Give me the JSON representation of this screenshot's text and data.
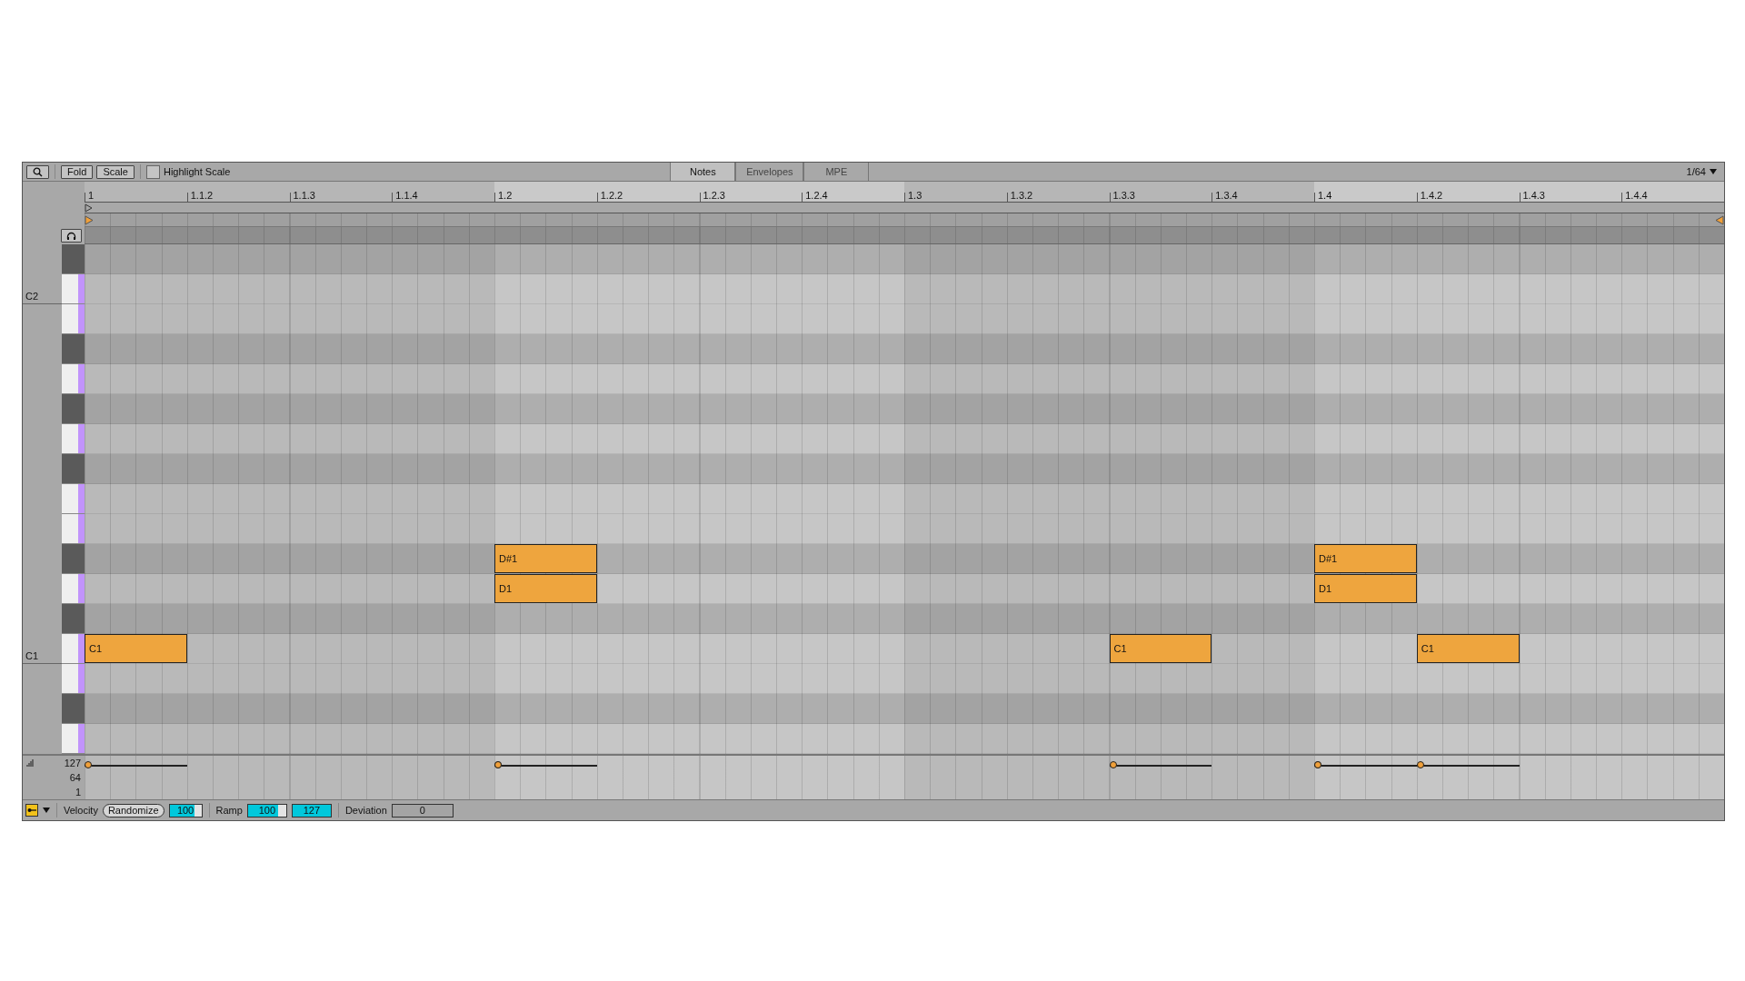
{
  "toolbar": {
    "buttons": [
      "Fold",
      "Scale"
    ],
    "highlight_scale": {
      "label": "Highlight Scale",
      "checked": false
    }
  },
  "tabs": [
    {
      "label": "Notes",
      "selected": true
    },
    {
      "label": "Envelopes",
      "selected": false
    },
    {
      "label": "MPE",
      "selected": false
    }
  ],
  "grid_size": "1/64",
  "ruler": [
    "1",
    "1.1.2",
    "1.1.3",
    "1.1.4",
    "1.2",
    "1.2.2",
    "1.2.3",
    "1.2.4",
    "1.3",
    "1.3.2",
    "1.3.3",
    "1.3.4",
    "1.4",
    "1.4.2",
    "1.4.3",
    "1.4.4"
  ],
  "keys": [
    {
      "kind": "black"
    },
    {
      "kind": "white",
      "label": "C2"
    },
    {
      "kind": "white"
    },
    {
      "kind": "black"
    },
    {
      "kind": "white"
    },
    {
      "kind": "black"
    },
    {
      "kind": "white"
    },
    {
      "kind": "black"
    },
    {
      "kind": "white"
    },
    {
      "kind": "white"
    },
    {
      "kind": "black",
      "notes": [
        {
          "label": "D#1"
        },
        {
          "label": "D#1"
        }
      ]
    },
    {
      "kind": "white",
      "notes": [
        {
          "label": "D1"
        },
        {
          "label": "D1"
        }
      ]
    },
    {
      "kind": "black"
    },
    {
      "kind": "white",
      "label": "C1",
      "notes": [
        {
          "label": "C1"
        },
        {
          "label": "C1"
        },
        {
          "label": "C1"
        }
      ]
    },
    {
      "kind": "white"
    },
    {
      "kind": "black"
    },
    {
      "kind": "white"
    }
  ],
  "velocity_lane": {
    "ticks": [
      "127",
      "64",
      "1"
    ]
  },
  "bottom_bar": {
    "pin_toggle": {
      "on": true
    },
    "velocity_label": "Velocity",
    "randomize": "Randomize",
    "velocity_field": {
      "value": "100",
      "level": 0.78
    },
    "ramp_label": "Ramp",
    "ramp_fields": [
      {
        "value": "100",
        "level": 0.78
      },
      {
        "value": "127",
        "level": 1
      }
    ],
    "deviation_label": "Deviation",
    "deviation_field": {
      "value": "0"
    }
  }
}
